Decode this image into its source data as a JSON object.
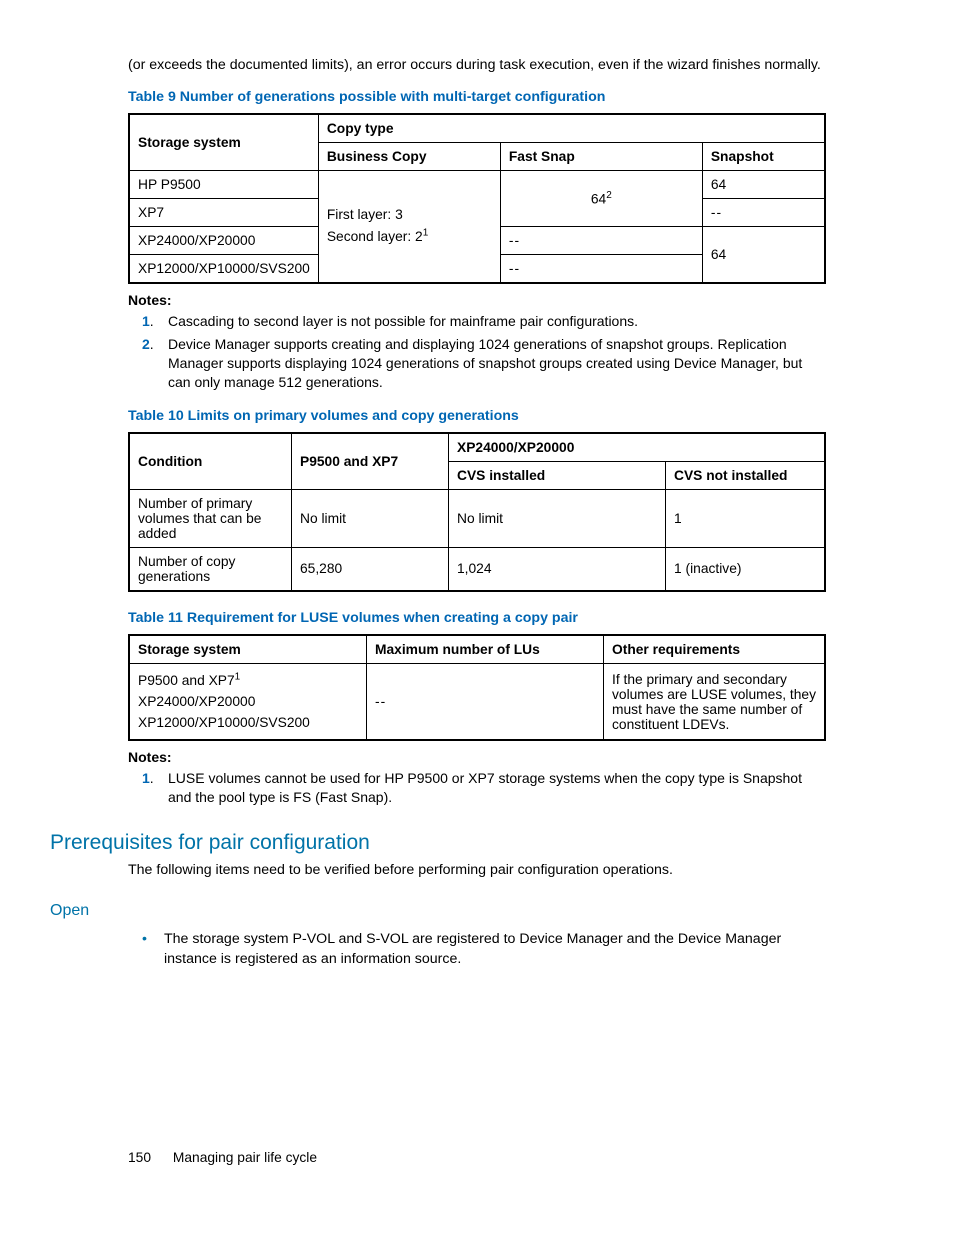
{
  "intro_paragraph": "(or exceeds the documented limits), an error occurs during task execution, even if the wizard finishes normally.",
  "t9": {
    "caption": "Table 9 Number of generations possible with multi-target configuration",
    "h_storage": "Storage system",
    "h_copytype": "Copy type",
    "h_bc": "Business Copy",
    "h_fs": "Fast Snap",
    "h_snap": "Snapshot",
    "r1c1": "HP P9500",
    "r2c1": "XP7",
    "r3c1": "XP24000/XP20000",
    "r4c1": "XP12000/XP10000/SVS200",
    "bc_line1": "First layer: 3",
    "bc_line2_pre": "Second layer: 2",
    "bc_line2_sup": "1",
    "fs_12_pre": "64",
    "fs_12_sup": "2",
    "fs_3": "--",
    "fs_4": "--",
    "snap_1": "64",
    "snap_2": "--",
    "snap_34": "64"
  },
  "t9_notes": {
    "title": "Notes:",
    "n1_num": "1",
    "n1": "Cascading to second layer is not possible for mainframe pair configurations.",
    "n2_num": "2",
    "n2": "Device Manager supports creating and displaying 1024 generations of snapshot groups. Replication Manager supports displaying 1024 generations of snapshot groups created using Device Manager, but can only manage 512 generations."
  },
  "t10": {
    "caption": "Table 10 Limits on primary volumes and copy generations",
    "h_condition": "Condition",
    "h_p9500": "P9500 and XP7",
    "h_xp24": "XP24000/XP20000",
    "h_cvs_i": "CVS installed",
    "h_cvs_n": "CVS not installed",
    "r1c1": "Number of primary volumes that can be added",
    "r1c2": "No limit",
    "r1c3": "No limit",
    "r1c4": "1",
    "r2c1": "Number of copy generations",
    "r2c2": "65,280",
    "r2c3": "1,024",
    "r2c4": "1 (inactive)"
  },
  "t11": {
    "caption": "Table 11 Requirement for LUSE volumes when creating a copy pair",
    "h1": "Storage system",
    "h2": "Maximum number of LUs",
    "h3": "Other requirements",
    "ss_l1_pre": "P9500 and XP7",
    "ss_l1_sup": "1",
    "ss_l2": "XP24000/XP20000",
    "ss_l3": "XP12000/XP10000/SVS200",
    "maxlu": "--",
    "other": "If the primary and secondary volumes are LUSE volumes, they must have the same number of constituent LDEVs."
  },
  "t11_notes": {
    "title": "Notes:",
    "n1_num": "1",
    "n1": "LUSE volumes cannot be used for HP P9500 or XP7 storage systems when the copy type is Snapshot and the pool type is FS (Fast Snap)."
  },
  "section_prereq": "Prerequisites for pair configuration",
  "prereq_intro": "The following items need to be verified before performing pair configuration operations.",
  "subhead_open": "Open",
  "open_bullet1": "The storage system P-VOL and S-VOL are registered to Device Manager and the Device Manager instance is registered as an information source.",
  "footer_page": "150",
  "footer_title": "Managing pair life cycle",
  "chart_data": [
    {
      "type": "table",
      "title": "Table 9 Number of generations possible with multi-target configuration",
      "columns": [
        "Storage system",
        "Business Copy",
        "Fast Snap",
        "Snapshot"
      ],
      "rows": [
        [
          "HP P9500",
          "First layer: 3; Second layer: 2 (note 1)",
          "64 (note 2)",
          "64"
        ],
        [
          "XP7",
          "First layer: 3; Second layer: 2 (note 1)",
          "64 (note 2)",
          "--"
        ],
        [
          "XP24000/XP20000",
          "First layer: 3; Second layer: 2 (note 1)",
          "--",
          "64"
        ],
        [
          "XP12000/XP10000/SVS200",
          "First layer: 3; Second layer: 2 (note 1)",
          "--",
          "64"
        ]
      ]
    },
    {
      "type": "table",
      "title": "Table 10 Limits on primary volumes and copy generations",
      "columns": [
        "Condition",
        "P9500 and XP7",
        "XP24000/XP20000 – CVS installed",
        "XP24000/XP20000 – CVS not installed"
      ],
      "rows": [
        [
          "Number of primary volumes that can be added",
          "No limit",
          "No limit",
          "1"
        ],
        [
          "Number of copy generations",
          "65,280",
          "1,024",
          "1 (inactive)"
        ]
      ]
    },
    {
      "type": "table",
      "title": "Table 11 Requirement for LUSE volumes when creating a copy pair",
      "columns": [
        "Storage system",
        "Maximum number of LUs",
        "Other requirements"
      ],
      "rows": [
        [
          "P9500 and XP7 (note 1); XP24000/XP20000; XP12000/XP10000/SVS200",
          "--",
          "If the primary and secondary volumes are LUSE volumes, they must have the same number of constituent LDEVs."
        ]
      ]
    }
  ]
}
